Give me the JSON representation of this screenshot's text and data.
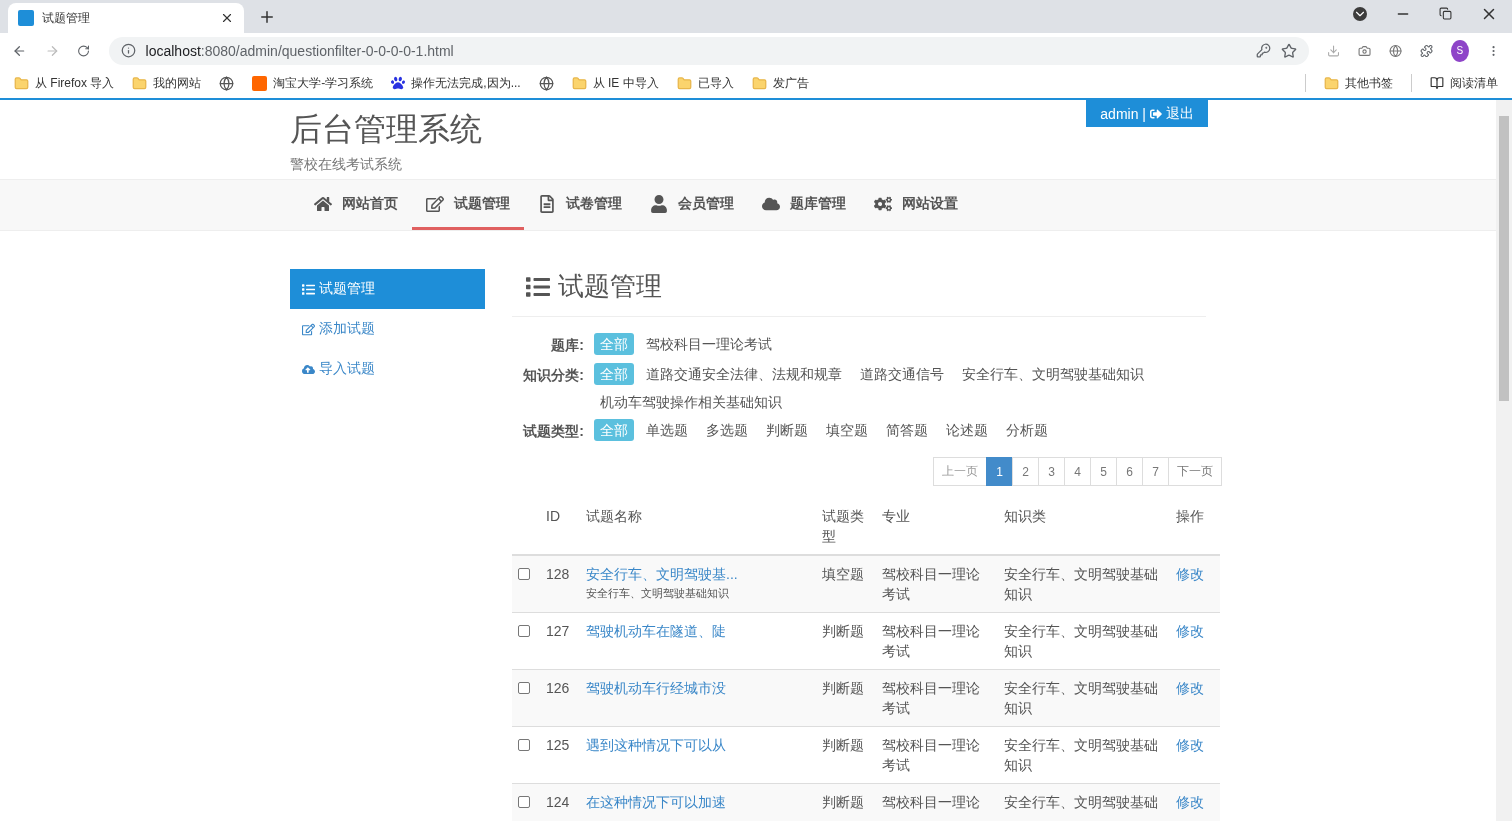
{
  "browser": {
    "tab": {
      "title": "试题管理"
    },
    "url_host": "localhost",
    "url_rest": ":8080/admin/questionfilter-0-0-0-0-1.html",
    "profile_initial": "S",
    "bookmarks": [
      {
        "kind": "folder",
        "label": "从 Firefox 导入"
      },
      {
        "kind": "folder",
        "label": "我的网站"
      },
      {
        "kind": "globe"
      },
      {
        "kind": "taobao",
        "label": "淘宝大学-学习系统"
      },
      {
        "kind": "paw",
        "label": "操作无法完成,因为..."
      },
      {
        "kind": "globe"
      },
      {
        "kind": "folder",
        "label": "从 IE 中导入"
      },
      {
        "kind": "folder",
        "label": "已导入"
      },
      {
        "kind": "folder",
        "label": "发广告"
      }
    ],
    "other_bookmarks": "其他书签",
    "reading_list": "阅读清单"
  },
  "header": {
    "title": "后台管理系统",
    "subtitle": "警校在线考试系统",
    "user": "admin |",
    "logout": "退出"
  },
  "nav": [
    {
      "label": "网站首页",
      "selected": false
    },
    {
      "label": "试题管理",
      "selected": true
    },
    {
      "label": "试卷管理",
      "selected": false
    },
    {
      "label": "会员管理",
      "selected": false
    },
    {
      "label": "题库管理",
      "selected": false
    },
    {
      "label": "网站设置",
      "selected": false
    }
  ],
  "sidebar": [
    {
      "label": "试题管理",
      "selected": true
    },
    {
      "label": "添加试题",
      "selected": false
    },
    {
      "label": "导入试题",
      "selected": false
    }
  ],
  "page_title": "试题管理",
  "filters": [
    {
      "label": "题库:",
      "options": [
        {
          "label": "全部",
          "selected": true
        },
        {
          "label": "驾校科目一理论考试",
          "selected": false
        }
      ]
    },
    {
      "label": "知识分类:",
      "options": [
        {
          "label": "全部",
          "selected": true
        },
        {
          "label": "道路交通安全法律、法规和规章",
          "selected": false
        },
        {
          "label": "道路交通信号",
          "selected": false
        },
        {
          "label": "安全行车、文明驾驶基础知识",
          "selected": false
        },
        {
          "label": "机动车驾驶操作相关基础知识",
          "selected": false
        }
      ]
    },
    {
      "label": "试题类型:",
      "options": [
        {
          "label": "全部",
          "selected": true
        },
        {
          "label": "单选题",
          "selected": false
        },
        {
          "label": "多选题",
          "selected": false
        },
        {
          "label": "判断题",
          "selected": false
        },
        {
          "label": "填空题",
          "selected": false
        },
        {
          "label": "简答题",
          "selected": false
        },
        {
          "label": "论述题",
          "selected": false
        },
        {
          "label": "分析题",
          "selected": false
        }
      ]
    }
  ],
  "pagination": {
    "prev": "上一页",
    "next": "下一页",
    "pages": [
      {
        "label": "1",
        "selected": true
      },
      {
        "label": "2",
        "selected": false
      },
      {
        "label": "3",
        "selected": false
      },
      {
        "label": "4",
        "selected": false
      },
      {
        "label": "5",
        "selected": false
      },
      {
        "label": "6",
        "selected": false
      },
      {
        "label": "7",
        "selected": false
      }
    ]
  },
  "table": {
    "columns": [
      "ID",
      "试题名称",
      "试题类型",
      "专业",
      "知识类",
      "操作"
    ],
    "rows": [
      {
        "checked": false,
        "id": "128",
        "name": "安全行车、文明驾驶基...",
        "subtitle": "安全行车、文明驾驶基础知识",
        "type": "填空题",
        "major": "驾校科目一理论考试",
        "knowledge": "安全行车、文明驾驶基础知识",
        "action": "修改"
      },
      {
        "checked": false,
        "id": "127",
        "name": "驾驶机动车在隧道、陡",
        "type": "判断题",
        "major": "驾校科目一理论考试",
        "knowledge": "安全行车、文明驾驶基础知识",
        "action": "修改"
      },
      {
        "checked": false,
        "id": "126",
        "name": "驾驶机动车行经城市没",
        "type": "判断题",
        "major": "驾校科目一理论考试",
        "knowledge": "安全行车、文明驾驶基础知识",
        "action": "修改"
      },
      {
        "checked": false,
        "id": "125",
        "name": "遇到这种情况下可以从",
        "type": "判断题",
        "major": "驾校科目一理论考试",
        "knowledge": "安全行车、文明驾驶基础知识",
        "action": "修改"
      },
      {
        "checked": false,
        "id": "124",
        "name": "在这种情况下可以加速",
        "type": "判断题",
        "major": "驾校科目一理论",
        "knowledge": "安全行车、文明驾驶基础",
        "action": "修改"
      }
    ]
  }
}
